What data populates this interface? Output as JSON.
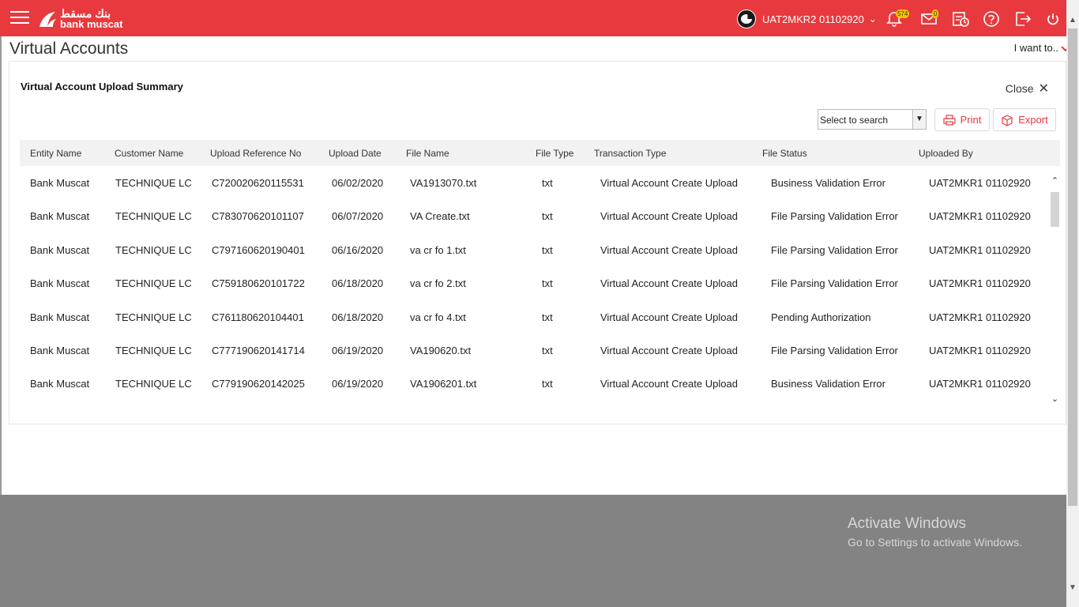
{
  "header": {
    "logo_arabic": "بنك مسقط",
    "logo_text": "bank muscat",
    "user_name": "UAT2MKR2 01102920",
    "notifications_count": "574",
    "mail_count": "0"
  },
  "page": {
    "title": "Virtual Accounts",
    "i_want_to": "I want to.."
  },
  "card": {
    "title": "Virtual Account Upload Summary",
    "close_label": "Close",
    "search_select": "Select to search",
    "print_label": "Print",
    "export_label": "Export"
  },
  "table": {
    "columns": [
      "Entity Name",
      "Customer Name",
      "Upload Reference No",
      "Upload Date",
      "File Name",
      "File Type",
      "Transaction Type",
      "File Status",
      "Uploaded By"
    ],
    "rows": [
      [
        "Bank Muscat",
        "TECHNIQUE LC",
        "C720020620115531",
        "06/02/2020",
        "VA1913070.txt",
        "txt",
        "Virtual Account Create Upload",
        "Business Validation Error",
        "UAT2MKR1 01102920"
      ],
      [
        "Bank Muscat",
        "TECHNIQUE LC",
        "C783070620101107",
        "06/07/2020",
        "VA Create.txt",
        "txt",
        "Virtual Account Create Upload",
        "File Parsing Validation Error",
        "UAT2MKR1 01102920"
      ],
      [
        "Bank Muscat",
        "TECHNIQUE LC",
        "C797160620190401",
        "06/16/2020",
        "va cr fo 1.txt",
        "txt",
        "Virtual Account Create Upload",
        "File Parsing Validation Error",
        "UAT2MKR1 01102920"
      ],
      [
        "Bank Muscat",
        "TECHNIQUE LC",
        "C759180620101722",
        "06/18/2020",
        "va cr fo 2.txt",
        "txt",
        "Virtual Account Create Upload",
        "File Parsing Validation Error",
        "UAT2MKR1 01102920"
      ],
      [
        "Bank Muscat",
        "TECHNIQUE LC",
        "C761180620104401",
        "06/18/2020",
        "va cr fo 4.txt",
        "txt",
        "Virtual Account Create Upload",
        "Pending Authorization",
        "UAT2MKR1 01102920"
      ],
      [
        "Bank Muscat",
        "TECHNIQUE LC",
        "C777190620141714",
        "06/19/2020",
        "VA190620.txt",
        "txt",
        "Virtual Account Create Upload",
        "File Parsing Validation Error",
        "UAT2MKR1 01102920"
      ],
      [
        "Bank Muscat",
        "TECHNIQUE LC",
        "C779190620142025",
        "06/19/2020",
        "VA1906201.txt",
        "txt",
        "Virtual Account Create Upload",
        "Business Validation Error",
        "UAT2MKR1 01102920"
      ]
    ]
  },
  "watermark": {
    "line1": "Activate Windows",
    "line2": "Go to Settings to activate Windows."
  },
  "colors": {
    "brand_red": "#e8393e",
    "badge_yellow": "#f5c400"
  }
}
